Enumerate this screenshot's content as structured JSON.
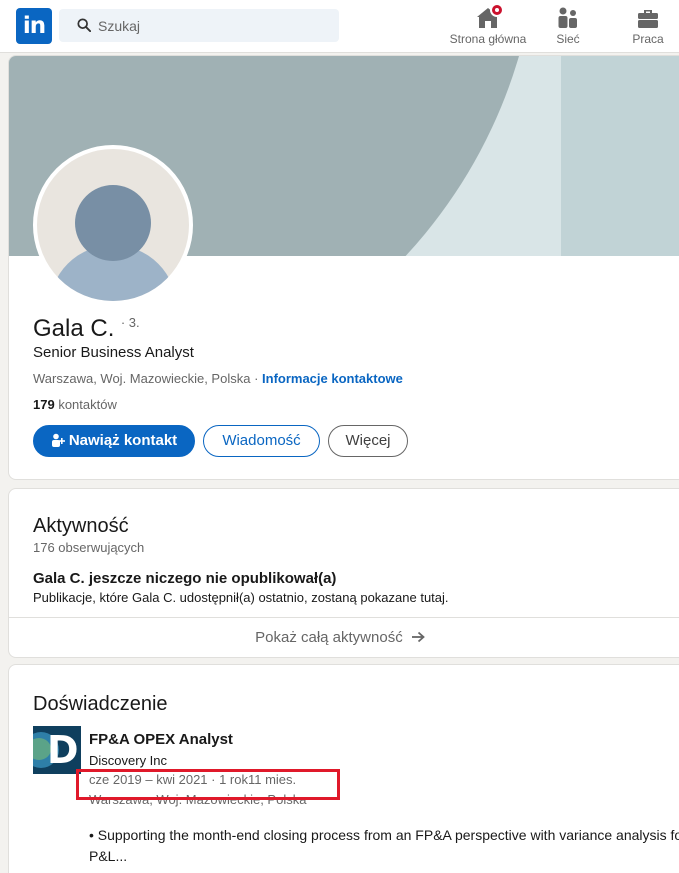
{
  "nav": {
    "logo_text": "in",
    "search_placeholder": "Szukaj",
    "items": [
      {
        "label": "Strona główna",
        "icon": "home-icon"
      },
      {
        "label": "Sieć",
        "icon": "network-icon"
      },
      {
        "label": "Praca",
        "icon": "briefcase-icon"
      }
    ],
    "colors": {
      "brand": "#0a66c2",
      "badge": "#cb112d"
    }
  },
  "profile": {
    "name": "Gala C.",
    "degree": "· 3.",
    "headline": "Senior Business Analyst",
    "location": "Warszawa, Woj. Mazowieckie, Polska",
    "location_sep": " · ",
    "contact_info": "Informacje kontaktowe",
    "connections_count": "179",
    "connections_label": "kontaktów",
    "buttons": {
      "connect": "Nawiąż kontakt",
      "message": "Wiadomość",
      "more": "Więcej"
    }
  },
  "activity": {
    "title": "Aktywność",
    "followers": "176 obserwujących",
    "empty_title": "Gala C. jeszcze niczego nie opublikował(a)",
    "empty_desc": "Publikacje, które Gala C. udostępnił(a) ostatnio, zostaną pokazane tutaj.",
    "show_all": "Pokaż całą aktywność"
  },
  "experience": {
    "title": "Doświadczenie",
    "items": [
      {
        "title": "FP&A OPEX Analyst",
        "company": "Discovery Inc",
        "dates": "cze 2019 – kwi 2021 · 1 rok11 mies.",
        "location": "Warszawa, Woj. Mazowieckie, Polska",
        "description": "• Supporting the month-end closing process from an FP&A perspective with variance analysis for P&L..."
      }
    ]
  }
}
